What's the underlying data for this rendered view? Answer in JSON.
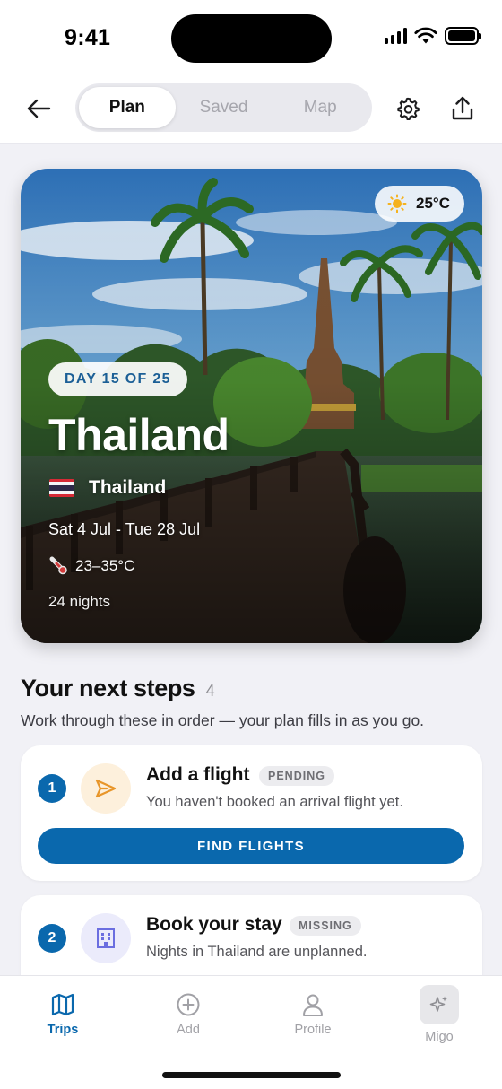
{
  "status_bar": {
    "time": "9:41"
  },
  "nav": {
    "tabs": [
      {
        "label": "Plan",
        "active": true
      },
      {
        "label": "Saved",
        "active": false
      },
      {
        "label": "Map",
        "active": false
      }
    ],
    "icons": [
      "back-arrow-icon",
      "gear-icon",
      "share-icon"
    ]
  },
  "hero": {
    "weather": {
      "icon": "sun-icon",
      "temp": "25°C"
    },
    "day_pill": "DAY 15 OF 25",
    "title": "Thailand",
    "country": "Thailand",
    "dates": "Sat 4 Jul - Tue 28 Jul",
    "temp_range": "23–35°C",
    "nights": "24 nights"
  },
  "steps": {
    "title": "Your next steps",
    "count": "4",
    "subtitle": "Work through these in order — your plan fills in as you go.",
    "items": [
      {
        "number": "1",
        "icon": "paper-plane-icon",
        "title": "Add a flight",
        "badge": "PENDING",
        "description": "You haven't booked an arrival flight yet.",
        "cta": "FIND FLIGHTS"
      },
      {
        "number": "2",
        "icon": "building-icon",
        "title": "Book your stay",
        "badge": "MISSING",
        "description": "Nights in Thailand are unplanned."
      }
    ]
  },
  "tab_bar": {
    "items": [
      {
        "label": "Trips",
        "icon": "map-icon",
        "active": true
      },
      {
        "label": "Add",
        "icon": "plus-circle-icon",
        "active": false
      },
      {
        "label": "Profile",
        "icon": "person-icon",
        "active": false
      },
      {
        "label": "Migo",
        "icon": "sparkle-icon",
        "active": false
      }
    ]
  },
  "colors": {
    "accent": "#0a68ad",
    "day_pill_text": "#1b5f96",
    "flight_icon_bg": "#fdf0dc",
    "flight_icon": "#e8962a",
    "stay_icon_bg": "#ebebfb",
    "stay_icon": "#6b6ee0"
  }
}
